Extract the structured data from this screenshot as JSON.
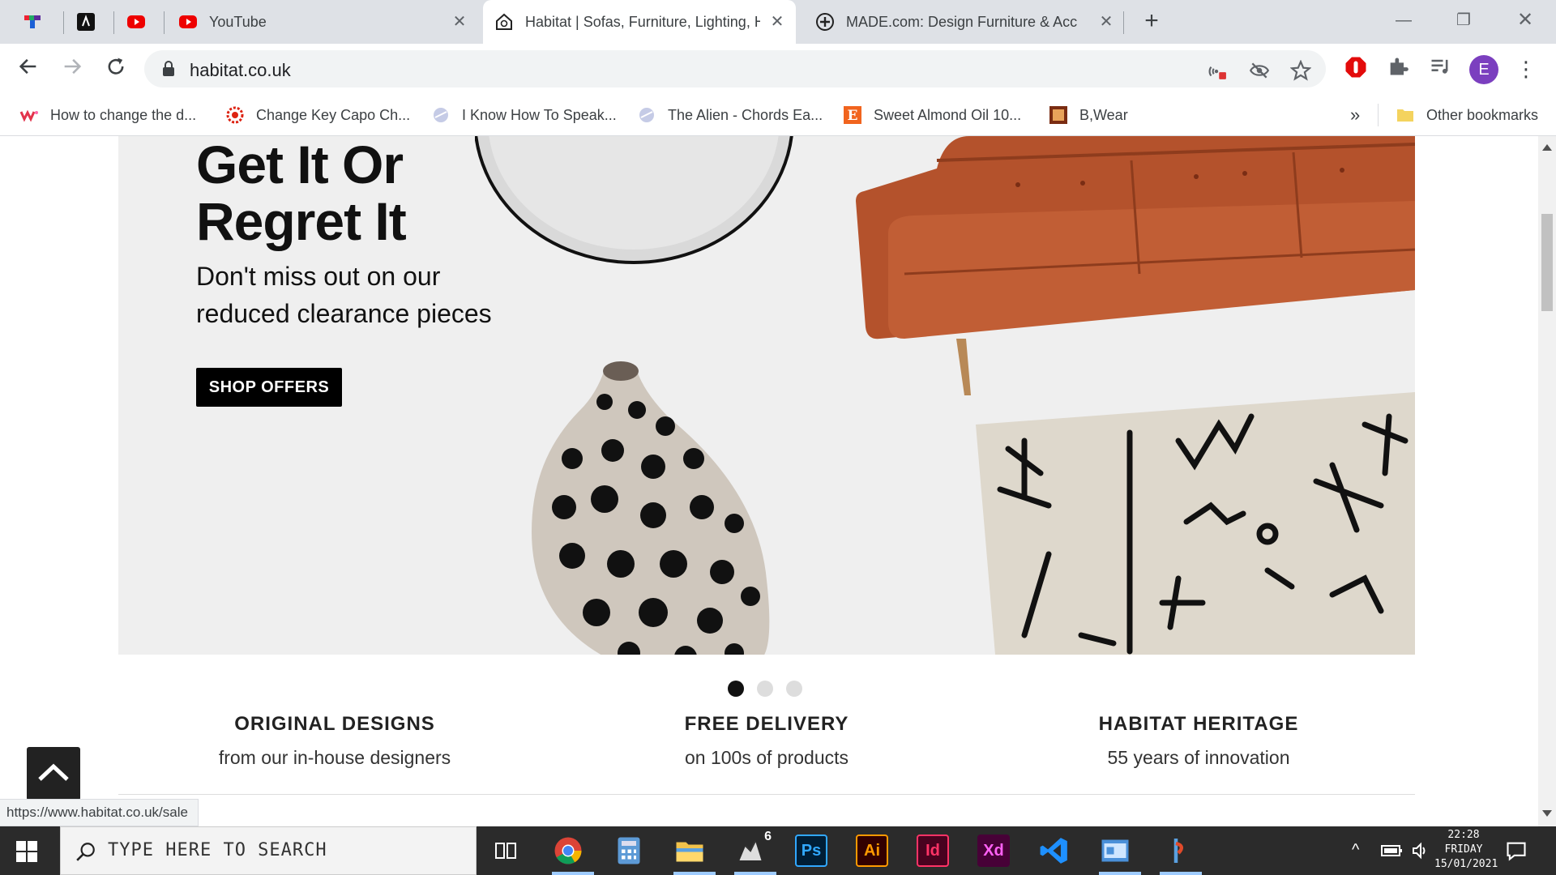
{
  "browser": {
    "tabs": [
      {
        "title": "",
        "icon": "tetris-icon"
      },
      {
        "title": "",
        "icon": "code-icon"
      },
      {
        "title": "",
        "icon": "youtube-icon"
      },
      {
        "title": "YouTube",
        "icon": "youtube-icon"
      },
      {
        "title": "Habitat | Sofas, Furniture, Lighting, H",
        "icon": "habitat-icon",
        "active": true
      },
      {
        "title": "MADE.com: Design Furniture & Acc",
        "icon": "made-icon"
      }
    ],
    "url": "habitat.co.uk",
    "avatar_letter": "E",
    "bookmarks": [
      "How to change the d...",
      "Change Key Capo Ch...",
      "I Know How To Speak...",
      "The Alien - Chords Ea...",
      "Sweet Almond Oil 10...",
      "B,Wear"
    ],
    "more_bookmarks": "»",
    "other_bookmarks": "Other bookmarks",
    "status_url": "https://www.habitat.co.uk/sale"
  },
  "hero": {
    "headline_line1": "Get It Or",
    "headline_line2": "Regret It",
    "subtitle": "Don't miss out on our reduced clearance pieces",
    "cta": "SHOP OFFERS",
    "slides": 3,
    "active_slide": 1
  },
  "usps": [
    {
      "title": "ORIGINAL DESIGNS",
      "text": "from our in-house designers"
    },
    {
      "title": "FREE DELIVERY",
      "text": "on 100s of products"
    },
    {
      "title": "HABITAT HERITAGE",
      "text": "55 years of innovation"
    }
  ],
  "taskbar": {
    "search_placeholder": "TYPE HERE TO SEARCH",
    "apps": [
      {
        "name": "task-view-icon",
        "label": ""
      },
      {
        "name": "chrome-icon",
        "label": ""
      },
      {
        "name": "calculator-icon",
        "label": ""
      },
      {
        "name": "file-explorer-icon",
        "label": ""
      },
      {
        "name": "rhino-icon",
        "label": "6"
      },
      {
        "name": "photoshop-icon",
        "label": "Ps",
        "color": "#31a8ff",
        "bg": "#001e36"
      },
      {
        "name": "illustrator-icon",
        "label": "Ai",
        "color": "#ff9a00",
        "bg": "#330000"
      },
      {
        "name": "indesign-icon",
        "label": "Id",
        "color": "#ff3366",
        "bg": "#49021f"
      },
      {
        "name": "xd-icon",
        "label": "Xd",
        "color": "#ff61f6",
        "bg": "#470137"
      },
      {
        "name": "vscode-icon",
        "label": ""
      },
      {
        "name": "control-panel-icon",
        "label": ""
      },
      {
        "name": "app-icon",
        "label": ""
      }
    ],
    "clock_time": "22:28",
    "clock_day": "FRIDAY",
    "clock_date": "15/01/2021"
  },
  "colors": {
    "avatar": "#7b3fbf",
    "hero_bg": "#efefef",
    "sofa": "#b4522c",
    "cta_bg": "#000000"
  }
}
